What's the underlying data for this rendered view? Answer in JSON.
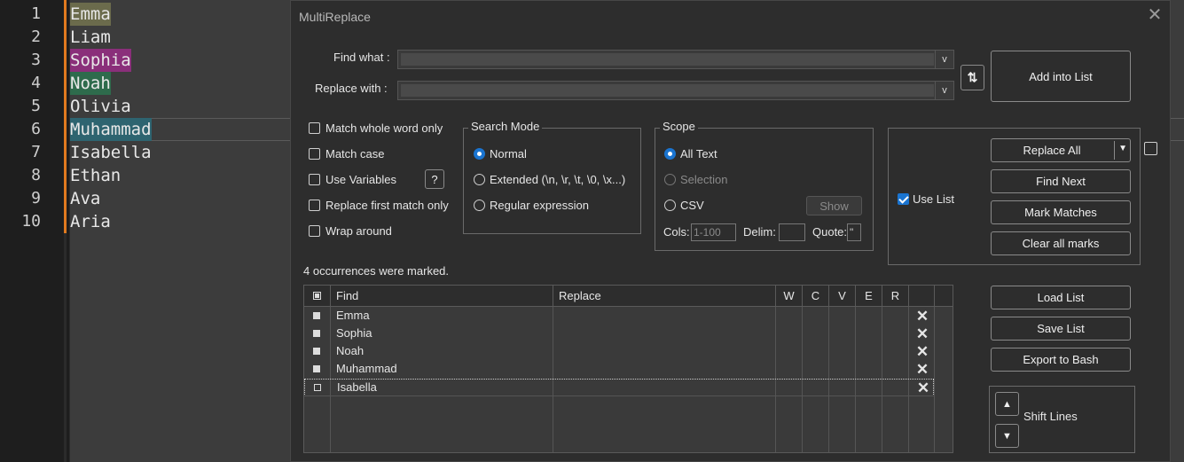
{
  "editor": {
    "lines": [
      {
        "num": "1",
        "text": "Emma"
      },
      {
        "num": "2",
        "text": "Liam"
      },
      {
        "num": "3",
        "text": "Sophia"
      },
      {
        "num": "4",
        "text": "Noah"
      },
      {
        "num": "5",
        "text": "Olivia"
      },
      {
        "num": "6",
        "text": "Muhammad"
      },
      {
        "num": "7",
        "text": "Isabella"
      },
      {
        "num": "8",
        "text": "Ethan"
      },
      {
        "num": "9",
        "text": "Ava"
      },
      {
        "num": "10",
        "text": "Aria"
      }
    ]
  },
  "dialog": {
    "title": "MultiReplace",
    "find_label": "Find what :",
    "replace_label": "Replace with :",
    "find_value": "",
    "replace_value": "",
    "dropdown_glyph": "v",
    "add_into_list": "Add into List",
    "options": {
      "match_whole_word": "Match whole word only",
      "match_case": "Match case",
      "use_variables": "Use Variables",
      "help": "?",
      "replace_first": "Replace first match only",
      "wrap_around": "Wrap around"
    },
    "search_mode": {
      "title": "Search Mode",
      "normal": "Normal",
      "extended": "Extended (\\n, \\r, \\t, \\0, \\x...)",
      "regex": "Regular expression"
    },
    "scope": {
      "title": "Scope",
      "all_text": "All Text",
      "selection": "Selection",
      "csv": "CSV",
      "show": "Show",
      "cols_label": "Cols:",
      "cols_placeholder": "1-100",
      "delim_label": "Delim:",
      "quote_label": "Quote:",
      "quote_value": "\""
    },
    "use_list": "Use List",
    "buttons": {
      "replace_all": "Replace All",
      "find_next": "Find Next",
      "mark_matches": "Mark Matches",
      "clear_marks": "Clear all marks",
      "load_list": "Load List",
      "save_list": "Save List",
      "export_bash": "Export to Bash",
      "shift_lines": "Shift Lines"
    },
    "status": "4 occurrences were marked.",
    "table": {
      "headers": {
        "find": "Find",
        "replace": "Replace",
        "w": "W",
        "c": "C",
        "v": "V",
        "e": "E",
        "r": "R"
      },
      "rows": [
        {
          "find": "Emma",
          "replace": "",
          "checked": true
        },
        {
          "find": "Sophia",
          "replace": "",
          "checked": true
        },
        {
          "find": "Noah",
          "replace": "",
          "checked": true
        },
        {
          "find": "Muhammad",
          "replace": "",
          "checked": true
        },
        {
          "find": "Isabella",
          "replace": "",
          "checked": false
        }
      ]
    }
  },
  "colors": {
    "accent": "#1a74d0",
    "gutter_marker": "#e07a1f"
  }
}
